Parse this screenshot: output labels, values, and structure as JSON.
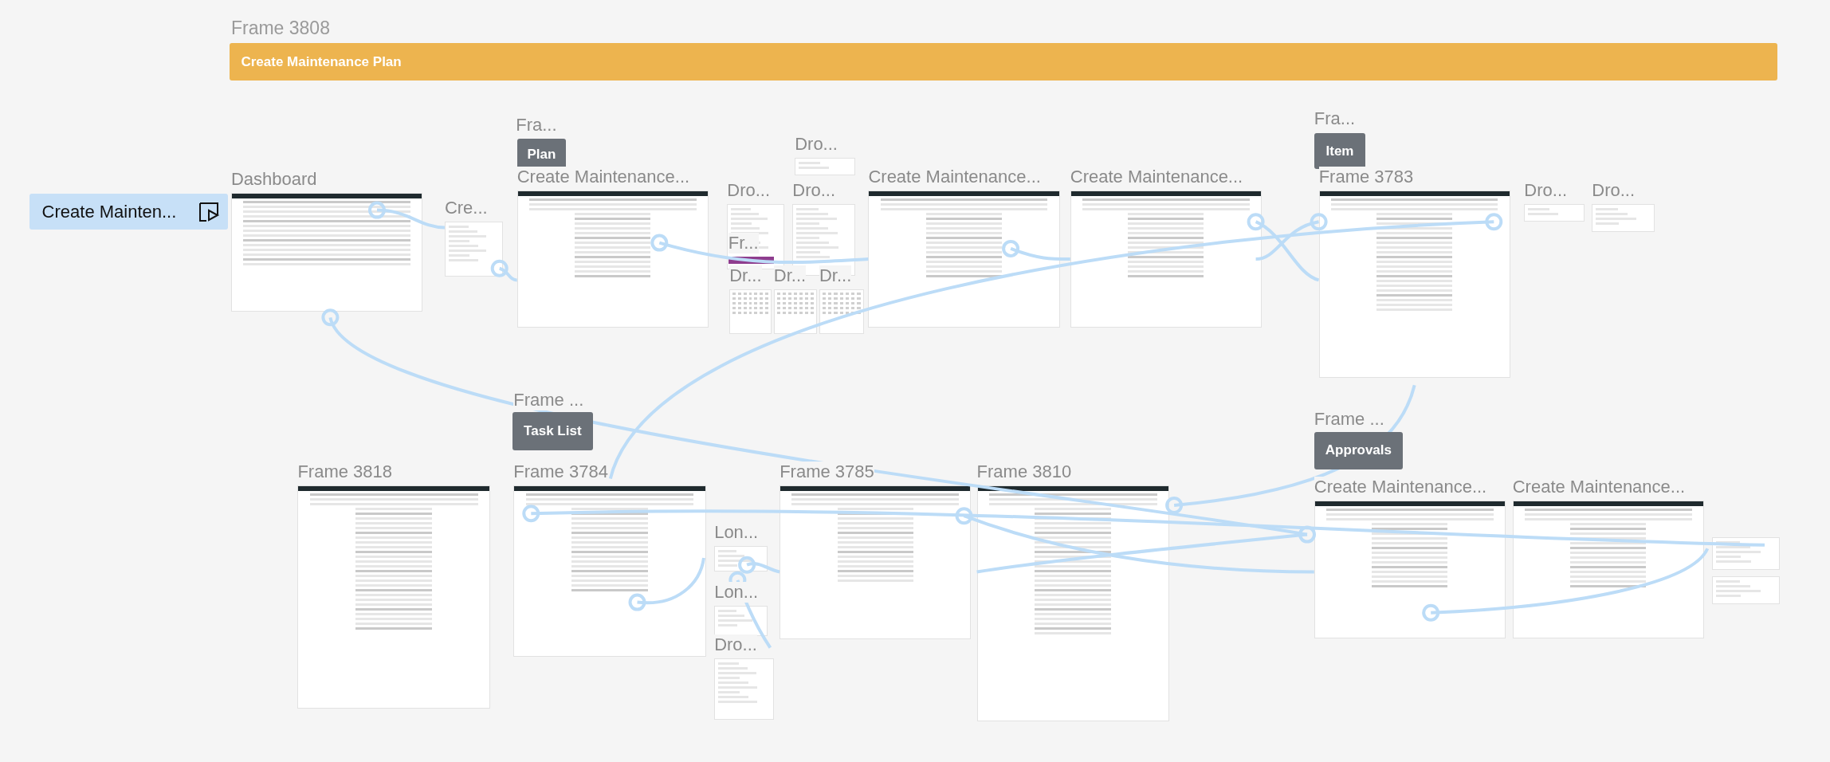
{
  "section": {
    "title": "Frame 3808",
    "banner": "Create Maintenance Plan"
  },
  "flow_start": {
    "label": "Create Mainten..."
  },
  "tags": [
    {
      "title": "Fra...",
      "label": "Plan"
    },
    {
      "title": "Fra...",
      "label": "Item"
    },
    {
      "title": "Frame ...",
      "label": "Task List"
    },
    {
      "title": "Frame ...",
      "label": "Approvals"
    }
  ],
  "frames": [
    {
      "label": "Dashboard",
      "kind": "table"
    },
    {
      "label": "Cre...",
      "kind": "popup"
    },
    {
      "label": "Create Maintenance...",
      "kind": "form"
    },
    {
      "label": "Dro...",
      "kind": "dropdown"
    },
    {
      "label": "Dro...",
      "kind": "dropdown"
    },
    {
      "label": "Dro...",
      "kind": "dropdown"
    },
    {
      "label": "Fr...",
      "kind": "toast"
    },
    {
      "label": "Dr...",
      "kind": "calendar"
    },
    {
      "label": "Dr...",
      "kind": "calendar"
    },
    {
      "label": "Dr...",
      "kind": "calendar"
    },
    {
      "label": "Create Maintenance...",
      "kind": "form"
    },
    {
      "label": "Create Maintenance...",
      "kind": "form"
    },
    {
      "label": "Frame 3783",
      "kind": "form"
    },
    {
      "label": "Dro...",
      "kind": "dropdown"
    },
    {
      "label": "Dro...",
      "kind": "dropdown"
    },
    {
      "label": "Frame 3818",
      "kind": "form"
    },
    {
      "label": "Frame 3784",
      "kind": "form"
    },
    {
      "label": "Frame 3785",
      "kind": "form"
    },
    {
      "label": "Frame 3810",
      "kind": "form"
    },
    {
      "label": "Lon...",
      "kind": "popup"
    },
    {
      "label": "Lon...",
      "kind": "popup"
    },
    {
      "label": "Dro...",
      "kind": "dropdown"
    },
    {
      "label": "Create Maintenance...",
      "kind": "form"
    },
    {
      "label": "Create Maintenance...",
      "kind": "form"
    },
    {
      "kind": "dropdown"
    },
    {
      "kind": "dropdown"
    }
  ]
}
